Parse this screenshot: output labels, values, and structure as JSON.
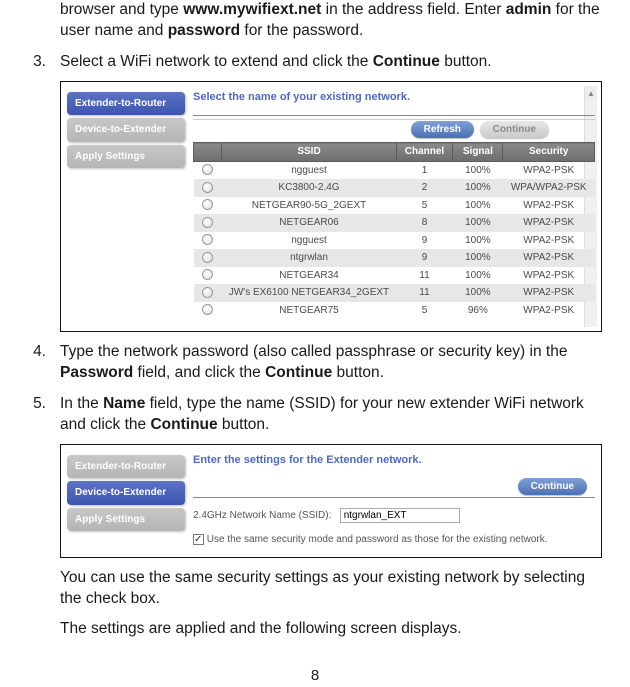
{
  "pre": {
    "line1a": "browser and type ",
    "url": "www.mywifiext.net",
    "line1b": " in the address field. Enter ",
    "adminWord": "admin",
    "line1c": " for the user name and ",
    "passwordWord": "password",
    "line1d": " for the password."
  },
  "steps": {
    "s3": {
      "num": "3.",
      "text_a": "Select a WiFi network to extend and click the ",
      "bold": "Continue",
      "text_b": " button."
    },
    "s4": {
      "num": "4.",
      "text_a": "Type the network password (also called passphrase or security key) in the ",
      "bold1": "Password",
      "text_b": " field, and click the ",
      "bold2": "Continue",
      "text_c": " button."
    },
    "s5": {
      "num": "5.",
      "text_a": "In the ",
      "bold1": "Name",
      "text_b": " field, type the name (SSID) for your new extender WiFi network and click the ",
      "bold2": "Continue",
      "text_c": " button."
    }
  },
  "shot1": {
    "tabs": [
      "Extender-to-Router",
      "Device-to-Extender",
      "Apply Settings"
    ],
    "title": "Select the name of your existing network.",
    "refresh": "Refresh",
    "continue": "Continue",
    "headers": {
      "ssid": "SSID",
      "channel": "Channel",
      "signal": "Signal",
      "security": "Security"
    },
    "rows": [
      {
        "ssid": "ngguest",
        "ch": "1",
        "sig": "100%",
        "sec": "WPA2-PSK"
      },
      {
        "ssid": "KC3800-2.4G",
        "ch": "2",
        "sig": "100%",
        "sec": "WPA/WPA2-PSK"
      },
      {
        "ssid": "NETGEAR90-5G_2GEXT",
        "ch": "5",
        "sig": "100%",
        "sec": "WPA2-PSK"
      },
      {
        "ssid": "NETGEAR06",
        "ch": "8",
        "sig": "100%",
        "sec": "WPA2-PSK"
      },
      {
        "ssid": "ngguest",
        "ch": "9",
        "sig": "100%",
        "sec": "WPA2-PSK"
      },
      {
        "ssid": "ntgrwlan",
        "ch": "9",
        "sig": "100%",
        "sec": "WPA2-PSK"
      },
      {
        "ssid": "NETGEAR34",
        "ch": "11",
        "sig": "100%",
        "sec": "WPA2-PSK"
      },
      {
        "ssid": "JW's EX6100 NETGEAR34_2GEXT",
        "ch": "11",
        "sig": "100%",
        "sec": "WPA2-PSK"
      },
      {
        "ssid": "NETGEAR75",
        "ch": "5",
        "sig": "96%",
        "sec": "WPA2-PSK"
      }
    ]
  },
  "shot2": {
    "tabs": [
      "Extender-to-Router",
      "Device-to-Extender",
      "Apply Settings"
    ],
    "title": "Enter the settings for the Extender network.",
    "continue": "Continue",
    "fieldLabel": "2.4GHz Network Name (SSID):",
    "fieldValue": "ntgrwlan_EXT",
    "checkboxLabel": "Use the same security mode and password as those for the existing network."
  },
  "post1": "You can use the same security settings as your existing network by selecting the check box.",
  "post2": "The settings are applied and the following screen displays.",
  "pageNum": "8"
}
